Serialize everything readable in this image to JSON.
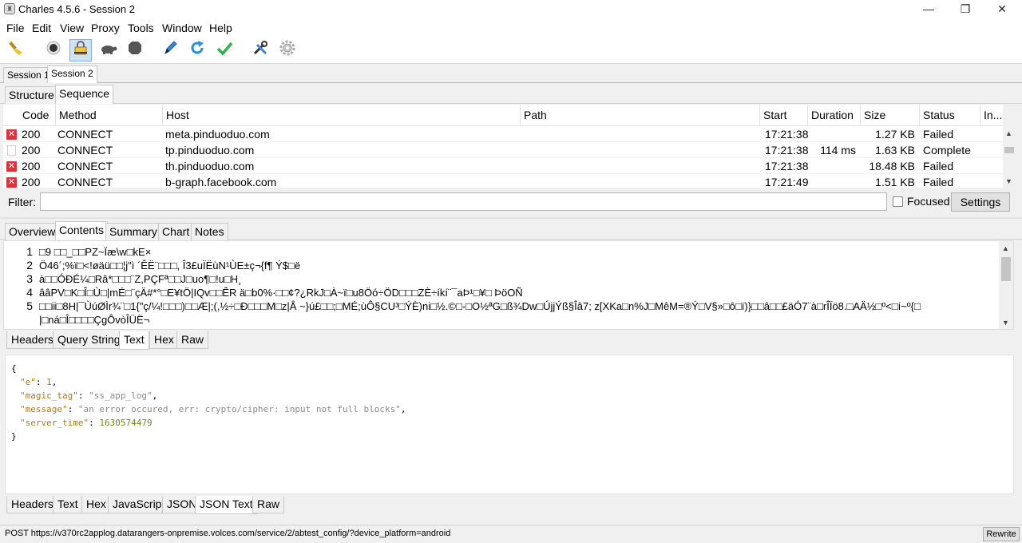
{
  "window": {
    "title": "Charles 4.5.6 - Session 2",
    "minimize": "—",
    "maximize": "❐",
    "close": "✕"
  },
  "menu": [
    "File",
    "Edit",
    "View",
    "Proxy",
    "Tools",
    "Window",
    "Help"
  ],
  "toolbar": {
    "icons": [
      "broom-icon",
      "record-icon",
      "ssl-proxy-icon",
      "throttle-turtle-icon",
      "breakpoint-icon",
      "compose-pen-icon",
      "repeat-icon",
      "validate-check-icon",
      "tools-icon",
      "settings-gear-icon"
    ]
  },
  "sessions": {
    "tabs": [
      "Session 1",
      "Session 2"
    ],
    "active": "Session 2"
  },
  "views": {
    "tabs": [
      "Structure",
      "Sequence"
    ],
    "active": "Sequence"
  },
  "table": {
    "columns": [
      "Code",
      "Method",
      "Host",
      "Path",
      "Start",
      "Duration",
      "Size",
      "Status",
      "In..."
    ],
    "rows": [
      {
        "state": "failed",
        "code": "200",
        "method": "CONNECT",
        "host": "meta.pinduoduo.com",
        "path": "",
        "start": "17:21:38",
        "duration": "",
        "size": "1.27 KB",
        "status": "Failed"
      },
      {
        "state": "complete",
        "code": "200",
        "method": "CONNECT",
        "host": "tp.pinduoduo.com",
        "path": "",
        "start": "17:21:38",
        "duration": "114 ms",
        "size": "1.63 KB",
        "status": "Complete"
      },
      {
        "state": "failed",
        "code": "200",
        "method": "CONNECT",
        "host": "th.pinduoduo.com",
        "path": "",
        "start": "17:21:38",
        "duration": "",
        "size": "18.48 KB",
        "status": "Failed"
      },
      {
        "state": "failed",
        "code": "200",
        "method": "CONNECT",
        "host": "b-graph.facebook.com",
        "path": "",
        "start": "17:21:49",
        "duration": "",
        "size": "1.51 KB",
        "status": "Failed"
      }
    ]
  },
  "filter": {
    "label": "Filter:",
    "value": "",
    "focused_label": "Focused",
    "settings_label": "Settings"
  },
  "detail_tabs": {
    "tabs": [
      "Overview",
      "Contents",
      "Summary",
      "Chart",
      "Notes"
    ],
    "active": "Contents"
  },
  "contents": {
    "lines": [
      {
        "n": "1",
        "text": "□9  □□_□□PZ~Ïæ\\w□kE×"
      },
      {
        "n": "2",
        "text": "Ö46´;%ï□<!øäü□□¦j\"ì ´ÊË¨□□□, Î3£uÏËùN¹ÙE±ç¬{f¶ Ý$□ë"
      },
      {
        "n": "3",
        "text": "à□□ÓÐÉ¼□Râ*□□□¨Z,PÇFª□□J□uo¶□!u□H¸"
      },
      {
        "n": "4",
        "text": "ââPV□K□Î□Ù□|mÉ□¨çÄ#*°□E¥tÖ|IQv□□ÊR              ä□b0%·□□¢?¿RkJ□À~ï□u8Öó÷ÖD□□□ZÈ÷íkí¨¯aÞ¹□¥□ ÞöOÑ"
      },
      {
        "n": "5",
        "text": "□□ii□8H|¯ÙúØÌr¾¨□1{\"ç/¼!□□□)□□Æ|;(,½÷□Ð□□□M□z|Å         ~}ú£□□;□MÉ;ùÔ§CU³□ÝÈ)ni□½.©□-□O½ªG□ß¾Dw□ÚjjÝß§Îâ7; z[XKa□n%J□MêM=®Ý□V§»□ô□ï)}□□â□□£äÓ7¨à□rÎÏö8.□AÄ½□º<□í~º{□"
      },
      {
        "n": "",
        "text": "|□ná□Î□□□□ÇgÔvòÎÜË¬"
      }
    ]
  },
  "request_tabs": {
    "tabs": [
      "Headers",
      "Query String",
      "Text",
      "Hex",
      "Raw"
    ],
    "active": "Text"
  },
  "json_text": {
    "open": "{",
    "entries": [
      {
        "key": "\"e\"",
        "sep": ": ",
        "value": "1",
        "kind": "num",
        "comma": ","
      },
      {
        "key": "\"magic_tag\"",
        "sep": ": ",
        "value": "\"ss_app_log\"",
        "kind": "str",
        "comma": ","
      },
      {
        "key": "\"message\"",
        "sep": ": ",
        "value": "\"an error occured, err: crypto/cipher: input not full blocks\"",
        "kind": "str",
        "comma": ","
      },
      {
        "key": "\"server_time\"",
        "sep": ": ",
        "value": "1630574479",
        "kind": "num",
        "comma": ""
      }
    ],
    "close": "}"
  },
  "response_tabs": {
    "tabs": [
      "Headers",
      "Text",
      "Hex",
      "JavaScript",
      "JSON",
      "JSON Text",
      "Raw"
    ],
    "active": "JSON Text"
  },
  "status": {
    "text": "POST https://v370rc2applog.datarangers-onpremise.volces.com/service/2/abtest_config/?device_platform=android",
    "rewrite_label": "Rewrite"
  },
  "colors": {
    "failed": "#d9343b",
    "json_key": "#b5761e",
    "json_string": "#8a8a8a",
    "json_number": "#6a8a1e"
  }
}
